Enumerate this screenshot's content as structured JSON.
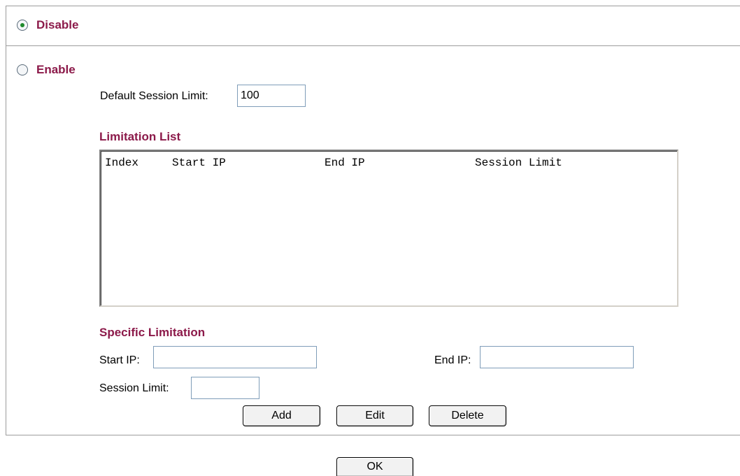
{
  "mode": {
    "disable_label": "Disable",
    "enable_label": "Enable",
    "selected": "disable"
  },
  "default_session_limit": {
    "label": "Default Session Limit:",
    "value": "100"
  },
  "limitation_list": {
    "title": "Limitation List",
    "columns": [
      "Index",
      "Start IP",
      "End IP",
      "Session Limit"
    ],
    "rows": []
  },
  "specific_limitation": {
    "title": "Specific Limitation",
    "start_ip_label": "Start IP:",
    "start_ip_value": "",
    "end_ip_label": "End IP:",
    "end_ip_value": "",
    "session_limit_label": "Session Limit:",
    "session_limit_value": ""
  },
  "buttons": {
    "add": "Add",
    "edit": "Edit",
    "delete": "Delete",
    "ok": "OK"
  },
  "colors": {
    "section_text": "#8c1a4a",
    "radio_dot": "#1f8a2c"
  }
}
